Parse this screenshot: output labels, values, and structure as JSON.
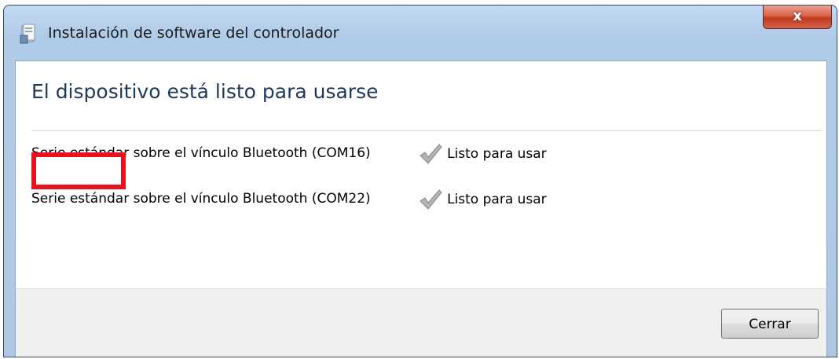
{
  "window": {
    "title": "Instalación de software del controlador",
    "close_label": "x"
  },
  "heading": "El dispositivo está listo para usarse",
  "devices": [
    {
      "name": "Serie estándar sobre el vínculo Bluetooth (COM16)",
      "status": "Listo para usar",
      "status_icon": "checkmark-icon"
    },
    {
      "name": "Serie estándar sobre el vínculo Bluetooth (COM22)",
      "status": "Listo para usar",
      "status_icon": "checkmark-icon"
    }
  ],
  "footer": {
    "close_button_label": "Cerrar"
  },
  "colors": {
    "heading": "#1e395b",
    "highlight": "#e8121c",
    "close_button": "#c13a1e"
  }
}
